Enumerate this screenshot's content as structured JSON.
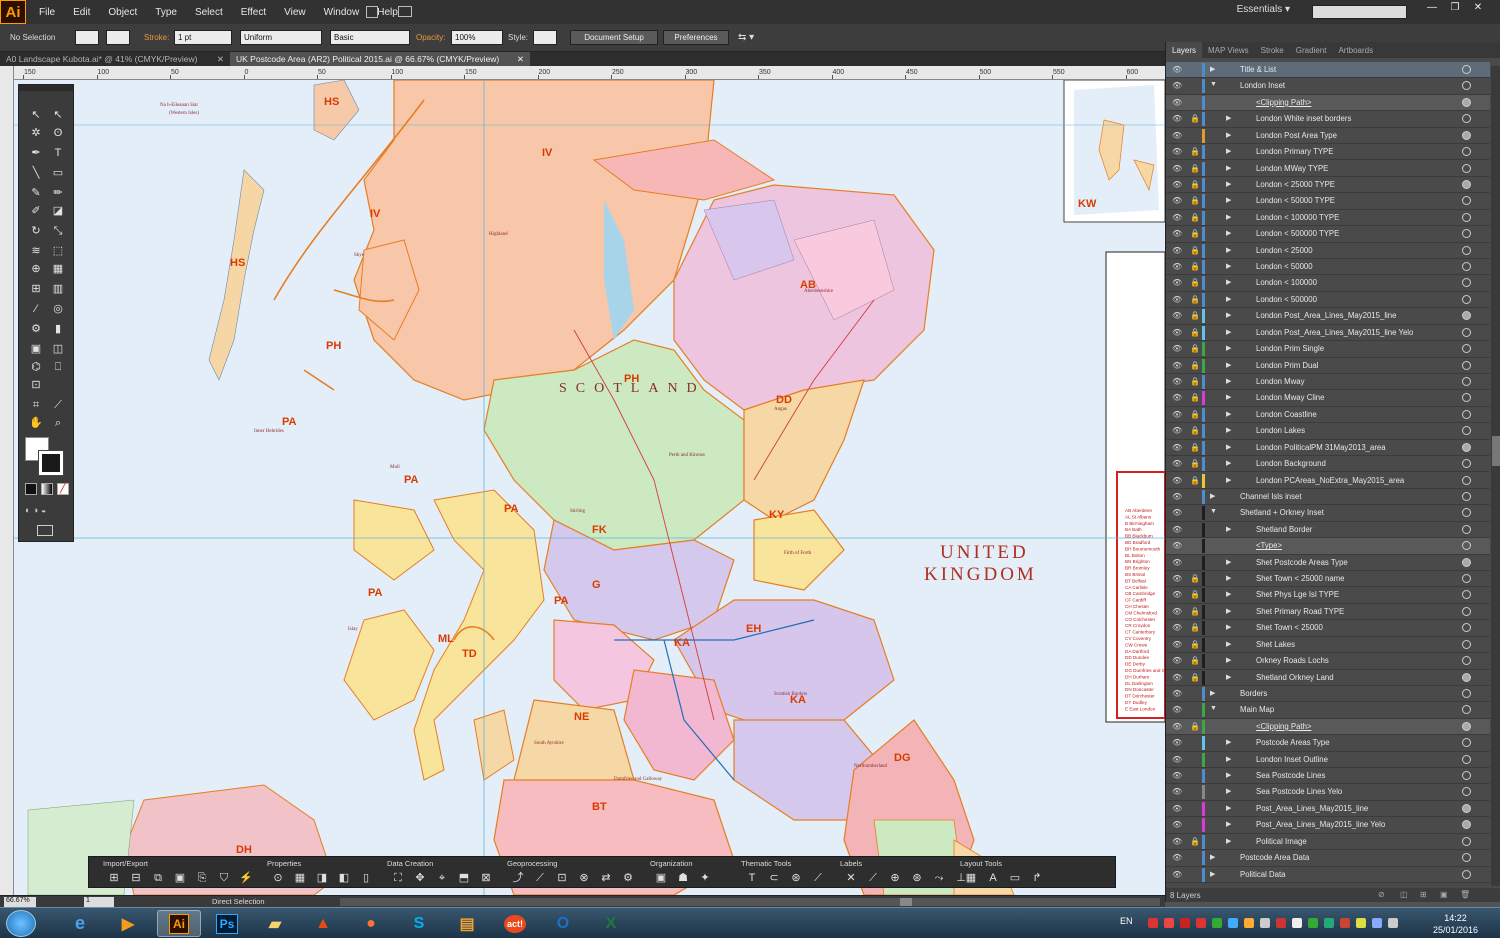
{
  "menubar": {
    "logo": "Ai",
    "items": [
      "File",
      "Edit",
      "Object",
      "Type",
      "Select",
      "Effect",
      "View",
      "Window",
      "Help"
    ],
    "workspace": "Essentials"
  },
  "controlbar": {
    "selection": "No Selection",
    "stroke_label": "Stroke:",
    "stroke_weight": "1 pt",
    "profile": "Uniform",
    "brush": "Basic",
    "opacity_label": "Opacity:",
    "opacity": "100%",
    "style_label": "Style:",
    "document_setup": "Document Setup",
    "preferences": "Preferences"
  },
  "tabs": [
    {
      "label": "A0 Landscape Kubota.ai* @ 41% (CMYK/Preview)",
      "active": false
    },
    {
      "label": "UK Postcode Area (AR2) Political 2015.ai @ 66.67% (CMYK/Preview)",
      "active": true
    }
  ],
  "ruler": {
    "ticks": [
      "150",
      "100",
      "50",
      "0",
      "50",
      "100",
      "150",
      "200",
      "250",
      "300",
      "350",
      "400",
      "450",
      "500",
      "550",
      "600"
    ]
  },
  "map": {
    "country": "SCOTLAND",
    "title_line1": "UNITED",
    "title_line2": "KINGDOM",
    "inset_label": "KW",
    "postcodes": [
      {
        "code": "HS"
      },
      {
        "code": "IV"
      },
      {
        "code": "IV"
      },
      {
        "code": "HS"
      },
      {
        "code": "PH"
      },
      {
        "code": "AB"
      },
      {
        "code": "PH"
      },
      {
        "code": "DD"
      },
      {
        "code": "PA"
      },
      {
        "code": "PA"
      },
      {
        "code": "PA"
      },
      {
        "code": "KY"
      },
      {
        "code": "FK"
      },
      {
        "code": "G"
      },
      {
        "code": "PA"
      },
      {
        "code": "EH"
      },
      {
        "code": "PA"
      },
      {
        "code": "ML"
      },
      {
        "code": "KA"
      },
      {
        "code": "TD"
      },
      {
        "code": "KA"
      },
      {
        "code": "NE"
      },
      {
        "code": "DG"
      },
      {
        "code": "BT"
      },
      {
        "code": "DH"
      }
    ],
    "places": [
      {
        "text": "Na h-Eileanan Siar"
      },
      {
        "text": "(Western Isles)"
      },
      {
        "text": "Skye"
      },
      {
        "text": "Islay"
      },
      {
        "text": "Angus"
      },
      {
        "text": "Stirling"
      },
      {
        "text": "Northumberland"
      },
      {
        "text": "Dumfries and Galloway"
      },
      {
        "text": "Aberdeenshire"
      },
      {
        "text": "Inner Hebrides"
      },
      {
        "text": "Mull"
      },
      {
        "text": "Perth and Kinross"
      },
      {
        "text": "Highland"
      },
      {
        "text": "South Ayrshire"
      },
      {
        "text": "Scottish Borders"
      },
      {
        "text": "Firth of Forth"
      }
    ],
    "legend": [
      "AB Aberdeen",
      "AL St Albans",
      "B Birmingham",
      "BA Bath",
      "BB Blackburn",
      "BD Bradford",
      "BH Bournemouth",
      "BL Bolton",
      "BN Brighton",
      "BR Bromley",
      "BS Bristol",
      "BT Belfast",
      "CA Carlisle",
      "CB Cambridge",
      "CF Cardiff",
      "CH Chester",
      "CM Chelmsford",
      "CO Colchester",
      "CR Croydon",
      "CT Canterbury",
      "CV Coventry",
      "CW Crewe",
      "DA Dartford",
      "DD Dundee",
      "DE Derby",
      "DG Dumfries and Galloway",
      "DH Durham",
      "DL Darlington",
      "DN Doncaster",
      "DT Dorchester",
      "DY Dudley",
      "E East London"
    ]
  },
  "layers_panel": {
    "tabs": [
      "Layers",
      "MAP Views",
      "Stroke",
      "Gradient",
      "Artboards"
    ],
    "rows": [
      {
        "name": "Title & List",
        "indent": 0,
        "color": "#4f8ccf",
        "lock": false,
        "arrow": "▶",
        "target": false,
        "sel": true
      },
      {
        "name": "London Inset",
        "indent": 0,
        "color": "#4f8ccf",
        "lock": false,
        "arrow": "▼",
        "target": false
      },
      {
        "name": "<Clipping Path>",
        "indent": 2,
        "color": "#4f8ccf",
        "lock": false,
        "arrow": "",
        "target": true,
        "hl": true,
        "underline": true
      },
      {
        "name": "London White inset borders",
        "indent": 1,
        "color": "#4f8ccf",
        "lock": true,
        "arrow": "▶",
        "target": false
      },
      {
        "name": "London Post Area Type",
        "indent": 1,
        "color": "#e39a2a",
        "lock": false,
        "arrow": "▶",
        "target": true
      },
      {
        "name": "London Primary TYPE",
        "indent": 1,
        "color": "#4f8ccf",
        "lock": true,
        "arrow": "▶",
        "target": false
      },
      {
        "name": "London MWay TYPE",
        "indent": 1,
        "color": "#4f8ccf",
        "lock": true,
        "arrow": "▶",
        "target": false
      },
      {
        "name": "London < 25000 TYPE",
        "indent": 1,
        "color": "#4f8ccf",
        "lock": true,
        "arrow": "▶",
        "target": true
      },
      {
        "name": "London < 50000 TYPE",
        "indent": 1,
        "color": "#4f8ccf",
        "lock": true,
        "arrow": "▶",
        "target": false
      },
      {
        "name": "London < 100000 TYPE",
        "indent": 1,
        "color": "#4f8ccf",
        "lock": true,
        "arrow": "▶",
        "target": false
      },
      {
        "name": "London < 500000 TYPE",
        "indent": 1,
        "color": "#4f8ccf",
        "lock": true,
        "arrow": "▶",
        "target": false
      },
      {
        "name": "London < 25000",
        "indent": 1,
        "color": "#4f8ccf",
        "lock": true,
        "arrow": "▶",
        "target": false
      },
      {
        "name": "London < 50000",
        "indent": 1,
        "color": "#4f8ccf",
        "lock": true,
        "arrow": "▶",
        "target": false
      },
      {
        "name": "London < 100000",
        "indent": 1,
        "color": "#4f8ccf",
        "lock": true,
        "arrow": "▶",
        "target": false
      },
      {
        "name": "London < 500000",
        "indent": 1,
        "color": "#4f8ccf",
        "lock": true,
        "arrow": "▶",
        "target": false
      },
      {
        "name": "London Post_Area_Lines_May2015_line",
        "indent": 1,
        "color": "#5fc6e8",
        "lock": true,
        "arrow": "▶",
        "target": true
      },
      {
        "name": "London Post_Area_Lines_May2015_line Yelo",
        "indent": 1,
        "color": "#5fc6e8",
        "lock": true,
        "arrow": "▶",
        "target": false
      },
      {
        "name": "London Prim Single",
        "indent": 1,
        "color": "#39a845",
        "lock": true,
        "arrow": "▶",
        "target": false
      },
      {
        "name": "London Prim Dual",
        "indent": 1,
        "color": "#39a845",
        "lock": true,
        "arrow": "▶",
        "target": false
      },
      {
        "name": "London Mway",
        "indent": 1,
        "color": "#4f8ccf",
        "lock": true,
        "arrow": "▶",
        "target": false
      },
      {
        "name": "London Mway Cline",
        "indent": 1,
        "color": "#d83bd8",
        "lock": true,
        "arrow": "▶",
        "target": false
      },
      {
        "name": "London Coastline",
        "indent": 1,
        "color": "#4f8ccf",
        "lock": true,
        "arrow": "▶",
        "target": false
      },
      {
        "name": "London Lakes",
        "indent": 1,
        "color": "#4f8ccf",
        "lock": true,
        "arrow": "▶",
        "target": false
      },
      {
        "name": "London PoliticalPM 31May2013_area",
        "indent": 1,
        "color": "#4f8ccf",
        "lock": true,
        "arrow": "▶",
        "target": true
      },
      {
        "name": "London Background",
        "indent": 1,
        "color": "#4f8ccf",
        "lock": true,
        "arrow": "▶",
        "target": false
      },
      {
        "name": "London PCAreas_NoExtra_May2015_area",
        "indent": 1,
        "color": "#e8c43a",
        "lock": true,
        "arrow": "▶",
        "target": false
      },
      {
        "name": "Channel Isls inset",
        "indent": 0,
        "color": "#4f8ccf",
        "lock": false,
        "arrow": "▶",
        "target": false
      },
      {
        "name": "Shetland + Orkney Inset",
        "indent": 0,
        "color": "#1e1e1e",
        "lock": false,
        "arrow": "▼",
        "target": false
      },
      {
        "name": "Shetland Border",
        "indent": 1,
        "color": "#1e1e1e",
        "lock": false,
        "arrow": "▶",
        "target": false
      },
      {
        "name": "<Type>",
        "indent": 2,
        "color": "#1e1e1e",
        "lock": false,
        "arrow": "",
        "target": false,
        "hl": true,
        "underline": true
      },
      {
        "name": "Shet Postcode Areas Type",
        "indent": 1,
        "color": "#1e1e1e",
        "lock": false,
        "arrow": "▶",
        "target": true
      },
      {
        "name": "Shet Town < 25000 name",
        "indent": 1,
        "color": "#1e1e1e",
        "lock": true,
        "arrow": "▶",
        "target": false
      },
      {
        "name": "Shet Phys Lge Isl TYPE",
        "indent": 1,
        "color": "#1e1e1e",
        "lock": true,
        "arrow": "▶",
        "target": false
      },
      {
        "name": "Shet Primary Road TYPE",
        "indent": 1,
        "color": "#1e1e1e",
        "lock": true,
        "arrow": "▶",
        "target": false
      },
      {
        "name": "Shet Town < 25000",
        "indent": 1,
        "color": "#1e1e1e",
        "lock": true,
        "arrow": "▶",
        "target": false
      },
      {
        "name": "Shet Lakes",
        "indent": 1,
        "color": "#1e1e1e",
        "lock": true,
        "arrow": "▶",
        "target": false
      },
      {
        "name": "Orkney Roads Lochs",
        "indent": 1,
        "color": "#1e1e1e",
        "lock": true,
        "arrow": "▶",
        "target": false
      },
      {
        "name": "Shetland Orkney Land",
        "indent": 1,
        "color": "#1e1e1e",
        "lock": true,
        "arrow": "▶",
        "target": true
      },
      {
        "name": "Borders",
        "indent": 0,
        "color": "#4f8ccf",
        "lock": false,
        "arrow": "▶",
        "target": false
      },
      {
        "name": "Main Map",
        "indent": 0,
        "color": "#39a845",
        "lock": false,
        "arrow": "▼",
        "target": false
      },
      {
        "name": "<Clipping Path>",
        "indent": 2,
        "color": "#39a845",
        "lock": true,
        "arrow": "",
        "target": true,
        "hl": true,
        "underline": true
      },
      {
        "name": "Postcode Areas Type",
        "indent": 1,
        "color": "#5fc6e8",
        "lock": false,
        "arrow": "▶",
        "target": false
      },
      {
        "name": "London Inset Outline",
        "indent": 1,
        "color": "#39a845",
        "lock": false,
        "arrow": "▶",
        "target": false
      },
      {
        "name": "Sea Postcode Lines",
        "indent": 1,
        "color": "#4f8ccf",
        "lock": false,
        "arrow": "▶",
        "target": false
      },
      {
        "name": "Sea Postcode Lines Yelo",
        "indent": 1,
        "color": "#888888",
        "lock": false,
        "arrow": "▶",
        "target": false
      },
      {
        "name": "Post_Area_Lines_May2015_line",
        "indent": 1,
        "color": "#d83bd8",
        "lock": false,
        "arrow": "▶",
        "target": true
      },
      {
        "name": "Post_Area_Lines_May2015_line Yelo",
        "indent": 1,
        "color": "#d83bd8",
        "lock": false,
        "arrow": "▶",
        "target": true
      },
      {
        "name": "Political Image",
        "indent": 1,
        "color": "#4f8ccf",
        "lock": true,
        "arrow": "▶",
        "target": false
      },
      {
        "name": "Postcode Area Data",
        "indent": 0,
        "color": "#4f8ccf",
        "lock": false,
        "arrow": "▶",
        "target": false
      },
      {
        "name": "Political Data",
        "indent": 0,
        "color": "#4f8ccf",
        "lock": false,
        "arrow": "▶",
        "target": false
      }
    ],
    "footer": "8 Layers"
  },
  "mapbar": {
    "sections": [
      "Import/Export",
      "Properties",
      "Data Creation",
      "Geoprocessing",
      "Organization",
      "Thematic Tools",
      "Labels",
      "Layout Tools"
    ]
  },
  "statusbar": {
    "zoom": "66.67%",
    "artboard": "1",
    "tool": "Direct Selection"
  },
  "taskbar": {
    "apps": [
      "Ai",
      "Ps",
      "act!"
    ],
    "lang": "EN",
    "time": "14:22",
    "date": "25/01/2016"
  }
}
